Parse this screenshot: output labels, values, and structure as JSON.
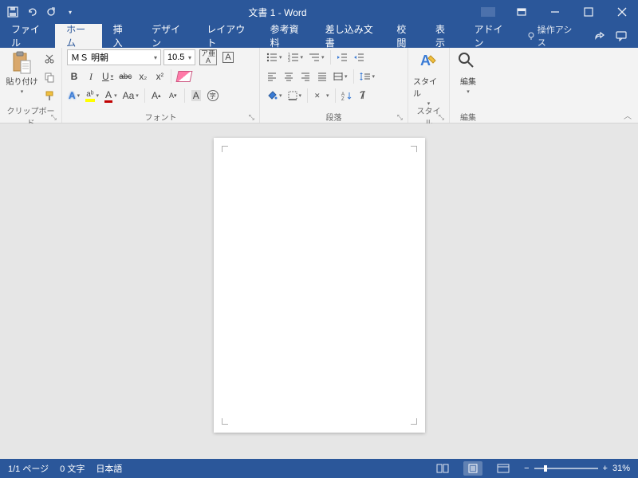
{
  "titlebar": {
    "title": "文書 1  -  Word"
  },
  "tabs": {
    "file": "ファイル",
    "home": "ホーム",
    "insert": "挿入",
    "design": "デザイン",
    "layout": "レイアウト",
    "references": "参考資料",
    "mailings": "差し込み文書",
    "review": "校閲",
    "view": "表示",
    "addins": "アドイン",
    "tellme": "操作アシス"
  },
  "ribbon": {
    "clipboard": {
      "label": "クリップボード",
      "paste": "貼り付け"
    },
    "font": {
      "label": "フォント",
      "name": "ＭＳ 明朝",
      "size": "10.5",
      "ruby_top": "ア亜",
      "ruby_bottom": "A",
      "charborder": "A",
      "bold": "B",
      "italic": "I",
      "underline": "U",
      "strike": "abc",
      "sub": "x",
      "sub2": "₂",
      "sup": "x",
      "sup2": "²",
      "texteffect": "A",
      "highlight": "aᵇ",
      "fontcolor": "A",
      "charscale": "Aa",
      "grow": "A",
      "shrink": "A",
      "enclosed": "A",
      "circled": "字"
    },
    "paragraph": {
      "label": "段落"
    },
    "styles": {
      "label": "スタイル",
      "btn": "スタイル"
    },
    "editing": {
      "label": "編集",
      "btn": "編集"
    }
  },
  "statusbar": {
    "page": "1/1 ページ",
    "words": "0 文字",
    "lang": "日本語",
    "zoom": "31%"
  }
}
